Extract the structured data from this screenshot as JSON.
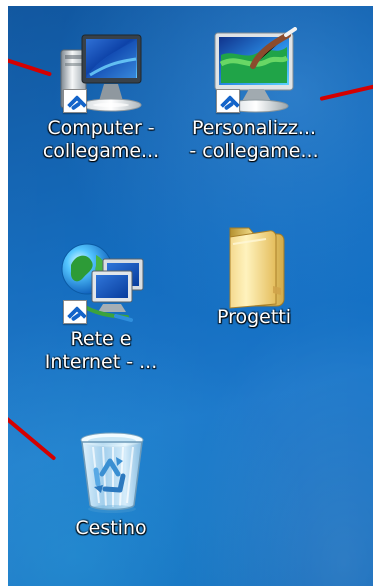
{
  "desktop": {
    "icons": [
      {
        "label": "Computer -\ncollegame...",
        "icon": "computer-icon"
      },
      {
        "label": "Personalizz...\n- collegame...",
        "icon": "personalization-monitor-icon"
      },
      {
        "label": "Rete e\nInternet - ...",
        "icon": "network-internet-icon"
      },
      {
        "label": "Progetti",
        "icon": "folder-icon"
      },
      {
        "label": "Cestino",
        "icon": "recycle-bin-icon"
      }
    ]
  },
  "colors": {
    "desktop_blue": "#0b67bc",
    "annotation_red": "#d40000",
    "label_text": "#ffffff"
  }
}
